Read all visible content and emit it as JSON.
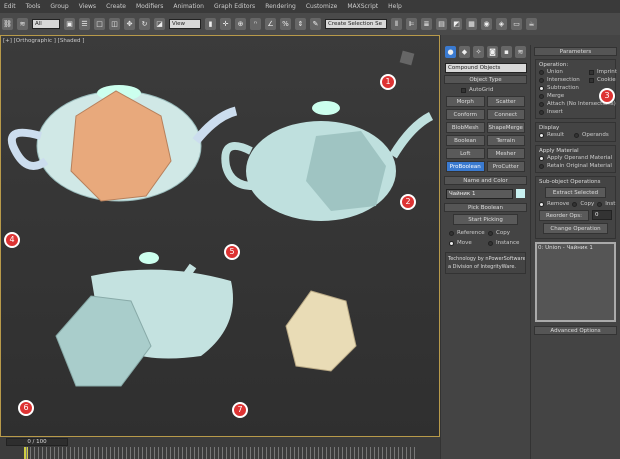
{
  "menu": [
    "Edit",
    "Tools",
    "Group",
    "Views",
    "Create",
    "Modifiers",
    "Animation",
    "Graph Editors",
    "Rendering",
    "Customize",
    "MAXScript",
    "Help"
  ],
  "toolbar": {
    "filter": "All",
    "refcoord": "View",
    "selection_set": "Create Selection Se"
  },
  "viewport": {
    "label": "[+] [Orthographic ] [Shaded ]"
  },
  "command_panel": {
    "category": "Compound Objects",
    "object_type": {
      "title": "Object Type",
      "autogrid": "AutoGrid",
      "buttons": [
        "Morph",
        "Scatter",
        "Conform",
        "Connect",
        "BlobMesh",
        "ShapeMerge",
        "Boolean",
        "Terrain",
        "Loft",
        "Mesher",
        "ProBoolean",
        "ProCutter"
      ],
      "active": "ProBoolean"
    },
    "name_color": {
      "title": "Name and Color",
      "name": "Чайник 1",
      "color": "#c8f0f0"
    },
    "pick_boolean": {
      "title": "Pick Boolean",
      "start": "Start Picking",
      "options": [
        "Reference",
        "Copy",
        "Move",
        "Instance"
      ],
      "selected": "Move",
      "credit1": "Technology by nPowerSoftware",
      "credit2": "a Division of IntegrityWare."
    }
  },
  "parameters": {
    "title": "Parameters",
    "operation_label": "Operation:",
    "operations": [
      "Union",
      "Intersection",
      "Subtraction",
      "Merge",
      "Attach (No Intersections)",
      "Insert"
    ],
    "selected": "Subtraction",
    "checks": [
      "Imprint",
      "Cookie"
    ],
    "display": {
      "title": "Display",
      "options": [
        "Result",
        "Operands"
      ],
      "selected": "Result"
    },
    "apply_material": {
      "title": "Apply Material",
      "options": [
        "Apply Operand Material",
        "Retain Original Material"
      ],
      "selected": "Apply Operand Material"
    },
    "subobject": {
      "title": "Sub-object Operations",
      "extract": "Extract Selected",
      "modes": [
        "Remove",
        "Copy",
        "Inst"
      ],
      "selected": "Remove",
      "reorder": "Reorder Ops:",
      "reorder_value": "0",
      "change": "Change Operation"
    },
    "list_item": "0: Union - Чайник 1",
    "advanced": "Advanced Options"
  },
  "timeline": {
    "frame": "0 / 100",
    "ticks": [
      "10",
      "20",
      "30",
      "40",
      "50",
      "60",
      "70",
      "80",
      "90",
      "100"
    ]
  },
  "callouts": [
    "1",
    "2",
    "3",
    "4",
    "5",
    "6",
    "7"
  ]
}
